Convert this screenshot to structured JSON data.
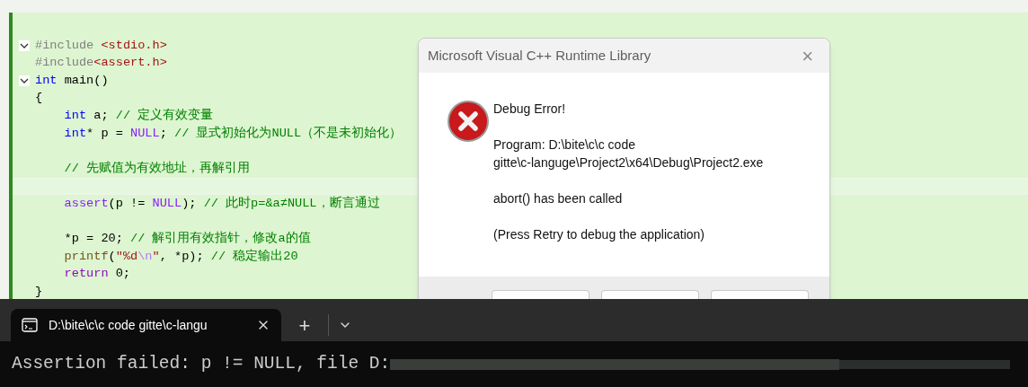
{
  "editor": {
    "lines": [
      {
        "fold": true,
        "current": false,
        "indent": false,
        "tokens": [
          {
            "kind": "preproc",
            "text": "#include "
          },
          {
            "kind": "string",
            "text": "<stdio.h>"
          }
        ]
      },
      {
        "fold": false,
        "current": false,
        "indent": false,
        "tokens": [
          {
            "kind": "preproc",
            "text": "#include"
          },
          {
            "kind": "string",
            "text": "<assert.h>"
          }
        ]
      },
      {
        "fold": true,
        "current": false,
        "indent": false,
        "tokens": [
          {
            "kind": "keyword",
            "text": "int"
          },
          {
            "kind": "plain",
            "text": " main()"
          }
        ]
      },
      {
        "fold": false,
        "current": false,
        "indent": false,
        "tokens": [
          {
            "kind": "plain",
            "text": "{"
          }
        ]
      },
      {
        "fold": false,
        "current": false,
        "indent": true,
        "tokens": [
          {
            "kind": "keyword",
            "text": "int"
          },
          {
            "kind": "plain",
            "text": " a; "
          },
          {
            "kind": "comment",
            "text": "// 定义有效变量"
          }
        ]
      },
      {
        "fold": false,
        "current": false,
        "indent": true,
        "tokens": [
          {
            "kind": "keyword",
            "text": "int"
          },
          {
            "kind": "plain",
            "text": "* p = "
          },
          {
            "kind": "macro",
            "text": "NULL"
          },
          {
            "kind": "plain",
            "text": "; "
          },
          {
            "kind": "comment",
            "text": "// 显式初始化为NULL（不是未初始化）"
          }
        ]
      },
      {
        "fold": false,
        "current": false
      },
      {
        "fold": false,
        "current": false,
        "indent": true,
        "tokens": [
          {
            "kind": "comment",
            "text": "// 先赋值为有效地址，再解引用"
          }
        ]
      },
      {
        "fold": false,
        "current": true
      },
      {
        "fold": false,
        "current": false,
        "indent": true,
        "tokens": [
          {
            "kind": "macro",
            "text": "assert"
          },
          {
            "kind": "plain",
            "text": "(p != "
          },
          {
            "kind": "macro",
            "text": "NULL"
          },
          {
            "kind": "plain",
            "text": "); "
          },
          {
            "kind": "comment",
            "text": "// 此时p=&a≠NULL，断言通过"
          }
        ]
      },
      {
        "fold": false,
        "current": false
      },
      {
        "fold": false,
        "current": false,
        "indent": true,
        "tokens": [
          {
            "kind": "plain",
            "text": "*p = 20; "
          },
          {
            "kind": "comment",
            "text": "// 解引用有效指针，修改a的值"
          }
        ]
      },
      {
        "fold": false,
        "current": false,
        "indent": true,
        "tokens": [
          {
            "kind": "function",
            "text": "printf"
          },
          {
            "kind": "plain",
            "text": "("
          },
          {
            "kind": "string",
            "text": "\"%d"
          },
          {
            "kind": "escape",
            "text": "\\n"
          },
          {
            "kind": "string",
            "text": "\""
          },
          {
            "kind": "plain",
            "text": ", *p); "
          },
          {
            "kind": "comment",
            "text": "// 稳定输出20"
          }
        ]
      },
      {
        "fold": false,
        "current": false,
        "indent": true,
        "tokens": [
          {
            "kind": "control",
            "text": "return"
          },
          {
            "kind": "plain",
            "text": " 0;"
          }
        ]
      },
      {
        "fold": false,
        "current": false,
        "indent": false,
        "tokens": [
          {
            "kind": "plain",
            "text": "}"
          }
        ]
      }
    ]
  },
  "dialog": {
    "title": "Microsoft Visual C++ Runtime Library",
    "close": "×",
    "heading": "Debug Error!",
    "program_line1": "Program: D:\\bite\\c\\c code",
    "program_line2": "gitte\\c-languge\\Project2\\x64\\Debug\\Project2.exe",
    "message": "abort() has been called",
    "hint": "(Press Retry to debug the application)"
  },
  "terminal": {
    "tab": {
      "title": "D:\\bite\\c\\c code gitte\\c-langu",
      "selected": true
    },
    "new_tab": "+",
    "output": "Assertion failed: p != NULL, file D:"
  }
}
